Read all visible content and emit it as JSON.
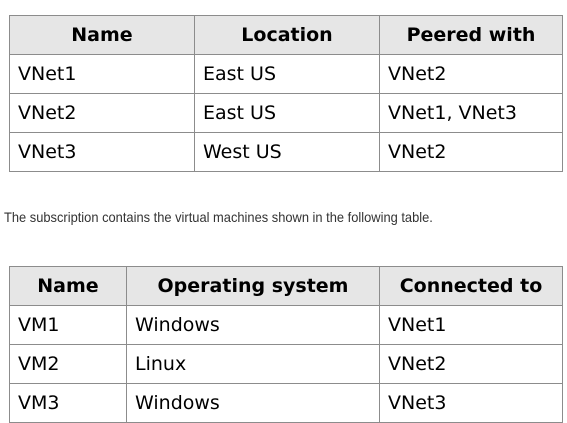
{
  "vnet_table": {
    "headers": [
      "Name",
      "Location",
      "Peered with"
    ],
    "rows": [
      [
        "VNet1",
        "East US",
        "VNet2"
      ],
      [
        "VNet2",
        "East US",
        "VNet1, VNet3"
      ],
      [
        "VNet3",
        "West US",
        "VNet2"
      ]
    ]
  },
  "caption": "The subscription contains the virtual machines shown in the following table.",
  "vm_table": {
    "headers": [
      "Name",
      "Operating system",
      "Connected to"
    ],
    "rows": [
      [
        "VM1",
        "Windows",
        "VNet1"
      ],
      [
        "VM2",
        "Linux",
        "VNet2"
      ],
      [
        "VM3",
        "Windows",
        "VNet3"
      ]
    ]
  }
}
